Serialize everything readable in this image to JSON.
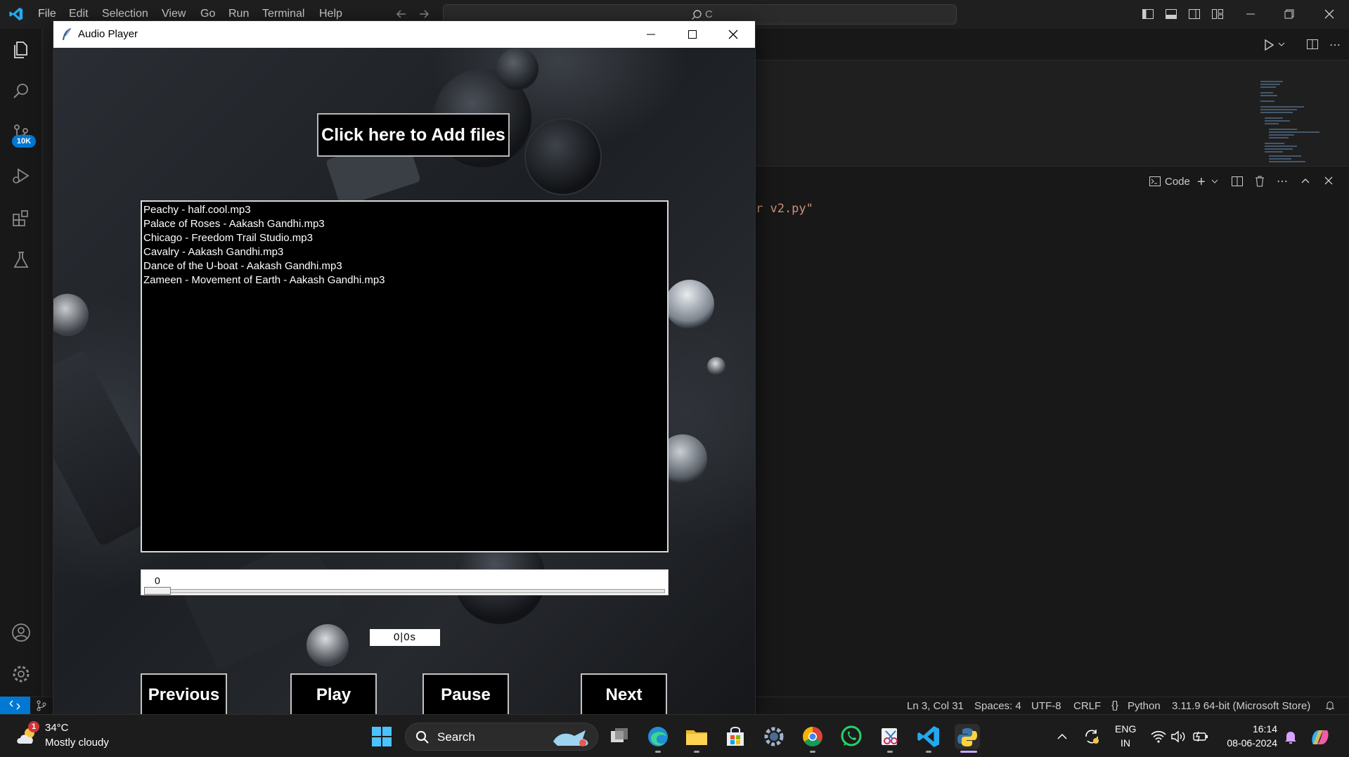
{
  "vscode": {
    "menu": [
      "File",
      "Edit",
      "Selection",
      "View",
      "Go",
      "Run",
      "Terminal",
      "Help"
    ],
    "search_text": "C",
    "scm_badge": "10K",
    "terminal_label": "Code",
    "terminal_snippet": "r v2.py\"",
    "status": {
      "position": "Ln 3, Col 31",
      "spaces": "Spaces: 4",
      "encoding": "UTF-8",
      "eol": "CRLF",
      "language": "Python",
      "interpreter": "3.11.9 64-bit (Microsoft Store)"
    },
    "icons": [
      "explorer-icon",
      "search-icon",
      "source-control-icon",
      "run-debug-icon",
      "extensions-icon",
      "testing-icon",
      "account-icon",
      "settings-icon"
    ]
  },
  "audio_player": {
    "window_title": "Audio Player",
    "add_files_label": "Click here to Add files",
    "tracks": [
      "Peachy - half.cool.mp3",
      "Palace of Roses - Aakash Gandhi.mp3",
      "Chicago - Freedom Trail Studio.mp3",
      "Cavalry - Aakash Gandhi.mp3",
      "Dance of the U-boat - Aakash Gandhi.mp3",
      "Zameen - Movement of Earth - Aakash Gandhi.mp3"
    ],
    "progress_value": "0",
    "progress_fraction": 0,
    "time_display": "0|0s",
    "buttons": {
      "previous": "Previous",
      "play": "Play",
      "pause": "Pause",
      "next": "Next"
    }
  },
  "taskbar": {
    "weather_badge": "1",
    "weather_temp": "34°C",
    "weather_desc": "Mostly cloudy",
    "search_label": "Search",
    "lang_line1": "ENG",
    "lang_line2": "IN",
    "time": "16:14",
    "date": "08-06-2024"
  }
}
